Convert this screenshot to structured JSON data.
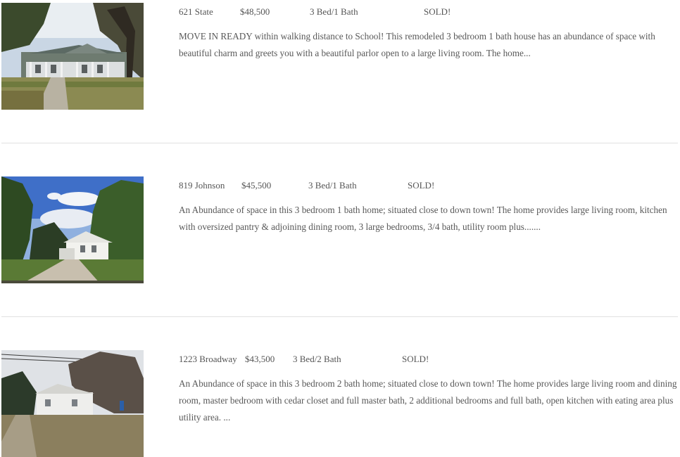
{
  "listings": [
    {
      "address": "621 State",
      "price": "$48,500",
      "beds_baths": "3 Bed/1 Bath",
      "status": "SOLD!",
      "description": "MOVE IN READY within walking distance to School!   This remodeled 3 bedroom 1 bath house has an abundance of space with beautiful charm and greets you with a beautiful parlor open to a large living room. The home...",
      "photo": "house-photo"
    },
    {
      "address": "819 Johnson",
      "price": "$45,500",
      "beds_baths": "3 Bed/1 Bath",
      "status": "SOLD!",
      "description": "An Abundance of space in this 3 bedroom 1 bath home; situated close to down town!    The home provides large living room, kitchen with oversized pantry & adjoining dining room, 3 large bedrooms, 3/4 bath, utility room plus.......",
      "photo": "house-photo"
    },
    {
      "address": "1223 Broadway",
      "price": "$43,500",
      "beds_baths": "3 Bed/2 Bath",
      "status": "SOLD!",
      "description": "An Abundance of space in this 3 bedroom 2 bath home; situated close to down town!    The home provides large living room and dining room, master bedroom with cedar closet and full master bath, 2 additional bedrooms and full bath, open kitchen with eating area plus utility area.  ...",
      "photo": "house-photo"
    }
  ]
}
